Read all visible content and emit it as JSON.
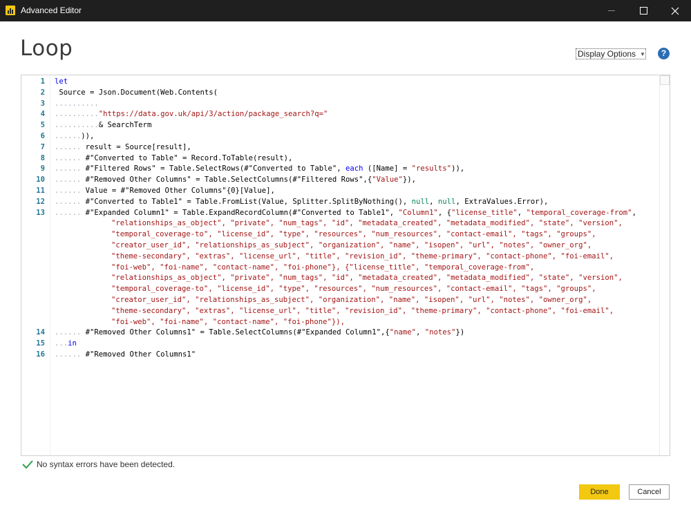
{
  "window": {
    "title": "Advanced Editor"
  },
  "query": {
    "name": "Loop"
  },
  "toolbar": {
    "display_options": "Display Options",
    "help": "?"
  },
  "editor": {
    "lines": [
      {
        "num": "1",
        "tokens": [
          {
            "t": "let",
            "c": "k"
          }
        ]
      },
      {
        "num": "2",
        "tokens": [
          {
            "t": " Source = Json.Document(Web.Contents(",
            "c": ""
          }
        ]
      },
      {
        "num": "3",
        "tokens": [
          {
            "t": "..........",
            "c": "dots"
          }
        ]
      },
      {
        "num": "4",
        "tokens": [
          {
            "t": "..........",
            "c": "dots"
          },
          {
            "t": "\"https://data.gov.uk/api/3/action/package_search?q=\"",
            "c": "s"
          }
        ]
      },
      {
        "num": "5",
        "tokens": [
          {
            "t": "..........",
            "c": "dots"
          },
          {
            "t": "& SearchTerm",
            "c": ""
          }
        ]
      },
      {
        "num": "6",
        "tokens": [
          {
            "t": "......",
            "c": "dots"
          },
          {
            "t": ")),",
            "c": ""
          }
        ]
      },
      {
        "num": "7",
        "tokens": [
          {
            "t": "......",
            "c": "dots"
          },
          {
            "t": " result = Source[result],",
            "c": ""
          }
        ]
      },
      {
        "num": "8",
        "tokens": [
          {
            "t": "......",
            "c": "dots"
          },
          {
            "t": " #\"Converted to Table\" = Record.ToTable(result),",
            "c": ""
          }
        ]
      },
      {
        "num": "9",
        "tokens": [
          {
            "t": "......",
            "c": "dots"
          },
          {
            "t": " #\"Filtered Rows\" = Table.SelectRows(#\"Converted to Table\", ",
            "c": ""
          },
          {
            "t": "each",
            "c": "k"
          },
          {
            "t": " ([Name] = ",
            "c": ""
          },
          {
            "t": "\"results\"",
            "c": "s"
          },
          {
            "t": ")),",
            "c": ""
          }
        ]
      },
      {
        "num": "10",
        "tokens": [
          {
            "t": "......",
            "c": "dots"
          },
          {
            "t": " #\"Removed Other Columns\" = Table.SelectColumns(#\"Filtered Rows\",{",
            "c": ""
          },
          {
            "t": "\"Value\"",
            "c": "s"
          },
          {
            "t": "}),",
            "c": ""
          }
        ]
      },
      {
        "num": "11",
        "tokens": [
          {
            "t": "......",
            "c": "dots"
          },
          {
            "t": " Value = #\"Removed Other Columns\"{0}[Value],",
            "c": ""
          }
        ]
      },
      {
        "num": "12",
        "tokens": [
          {
            "t": "......",
            "c": "dots"
          },
          {
            "t": " #\"Converted to Table1\" = Table.FromList(Value, Splitter.SplitByNothing(), ",
            "c": ""
          },
          {
            "t": "null",
            "c": "n"
          },
          {
            "t": ", ",
            "c": ""
          },
          {
            "t": "null",
            "c": "n"
          },
          {
            "t": ", ExtraValues.Error),",
            "c": ""
          }
        ]
      },
      {
        "num": "13",
        "tokens": [
          {
            "t": "......",
            "c": "dots"
          },
          {
            "t": " #\"Expanded Column1\" = Table.ExpandRecordColumn(#\"Converted to Table1\", ",
            "c": ""
          },
          {
            "t": "\"Column1\"",
            "c": "s"
          },
          {
            "t": ", {",
            "c": ""
          },
          {
            "t": "\"license_title\"",
            "c": "s"
          },
          {
            "t": ", ",
            "c": ""
          },
          {
            "t": "\"temporal_coverage-from\"",
            "c": "s"
          },
          {
            "t": ",",
            "c": ""
          }
        ]
      },
      {
        "num": "",
        "tokens": [
          {
            "t": "\"relationships_as_object\", \"private\", \"num_tags\", \"id\", \"metadata_created\", \"metadata_modified\", \"state\", \"version\",",
            "c": "s"
          }
        ]
      },
      {
        "num": "",
        "tokens": [
          {
            "t": "\"temporal_coverage-to\", \"license_id\", \"type\", \"resources\", \"num_resources\", \"contact-email\", \"tags\", \"groups\",",
            "c": "s"
          }
        ]
      },
      {
        "num": "",
        "tokens": [
          {
            "t": "\"creator_user_id\", \"relationships_as_subject\", \"organization\", \"name\", \"isopen\", \"url\", \"notes\", \"owner_org\",",
            "c": "s"
          }
        ]
      },
      {
        "num": "",
        "tokens": [
          {
            "t": "\"theme-secondary\", \"extras\", \"license_url\", \"title\", \"revision_id\", \"theme-primary\", \"contact-phone\", \"foi-email\",",
            "c": "s"
          }
        ]
      },
      {
        "num": "",
        "tokens": [
          {
            "t": "\"foi-web\", \"foi-name\", \"contact-name\", \"foi-phone\"}, {\"license_title\", \"temporal_coverage-from\",",
            "c": "s"
          }
        ]
      },
      {
        "num": "",
        "tokens": [
          {
            "t": "\"relationships_as_object\", \"private\", \"num_tags\", \"id\", \"metadata_created\", \"metadata_modified\", \"state\", \"version\",",
            "c": "s"
          }
        ]
      },
      {
        "num": "",
        "tokens": [
          {
            "t": "\"temporal_coverage-to\", \"license_id\", \"type\", \"resources\", \"num_resources\", \"contact-email\", \"tags\", \"groups\",",
            "c": "s"
          }
        ]
      },
      {
        "num": "",
        "tokens": [
          {
            "t": "\"creator_user_id\", \"relationships_as_subject\", \"organization\", \"name\", \"isopen\", \"url\", \"notes\", \"owner_org\",",
            "c": "s"
          }
        ]
      },
      {
        "num": "",
        "tokens": [
          {
            "t": "\"theme-secondary\", \"extras\", \"license_url\", \"title\", \"revision_id\", \"theme-primary\", \"contact-phone\", \"foi-email\",",
            "c": "s"
          }
        ]
      },
      {
        "num": "",
        "tokens": [
          {
            "t": "\"foi-web\", \"foi-name\", \"contact-name\", \"foi-phone\"}),",
            "c": "s"
          }
        ]
      },
      {
        "num": "14",
        "tokens": [
          {
            "t": "......",
            "c": "dots"
          },
          {
            "t": " #\"Removed Other Columns1\" = Table.SelectColumns(#\"Expanded Column1\",{",
            "c": ""
          },
          {
            "t": "\"name\"",
            "c": "s"
          },
          {
            "t": ", ",
            "c": ""
          },
          {
            "t": "\"notes\"",
            "c": "s"
          },
          {
            "t": "})",
            "c": ""
          }
        ]
      },
      {
        "num": "15",
        "tokens": [
          {
            "t": "...",
            "c": "dots"
          },
          {
            "t": "in",
            "c": "k"
          }
        ]
      },
      {
        "num": "16",
        "tokens": [
          {
            "t": "......",
            "c": "dots"
          },
          {
            "t": " #\"Removed Other Columns1\"",
            "c": ""
          }
        ]
      }
    ]
  },
  "status": {
    "message": "No syntax errors have been detected."
  },
  "buttons": {
    "done": "Done",
    "cancel": "Cancel"
  },
  "colors": {
    "accent": "#f2c811",
    "keyword": "#0000ff",
    "string": "#a31515",
    "literal": "#098658",
    "line_number": "#237893",
    "success": "#2e9e4f"
  }
}
